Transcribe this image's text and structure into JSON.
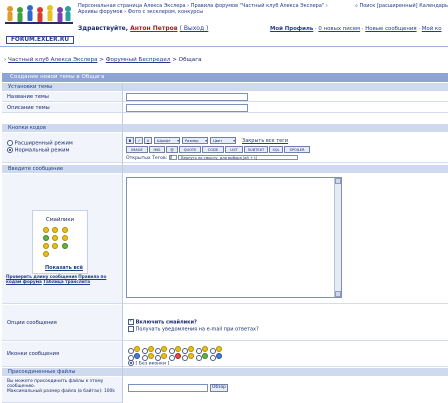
{
  "header": {
    "logo_text": "FORUM.EXLER.RU",
    "top_links": "Персональная страница Алекса Экслера › Правила форумов \"Частный клуб Алекса Экслера\" › Архивы форумов › Фото с эксклером, конкурсы",
    "top_links_right": "Поиск [расширенный] Календарь",
    "welcome_prefix": "Здравствуйте, ",
    "welcome_user": "Антон Петров",
    "welcome_logout": "( Выход )",
    "user_links": [
      "Мой Профиль",
      "0 новых писем",
      "Новые сообщения",
      "Мой ко"
    ]
  },
  "breadcrumb": {
    "items": [
      "Частный клуб Алекса Экслера",
      "Форумный Беспредел",
      "Общага"
    ],
    "sep": ">"
  },
  "form": {
    "title": "Создание новой темы в Общага",
    "section_topic": "Установки темы",
    "topic_name_label": "Название темы",
    "topic_desc_label": "Описание темы",
    "section_code": "Кнопки кодов",
    "mode_extended": "Расширенный режим",
    "mode_normal": "Нормальный режим",
    "close_all_tags": "Закрыть все теги",
    "fmt_buttons_row1": [
      "B",
      "I",
      "U",
      "Шрифт",
      "Размер",
      "Цвет"
    ],
    "fmt_buttons_row2": [
      "IMAGE",
      "IMG",
      "@",
      "QUOTE",
      "CODE",
      "LIST",
      "SUBTEXT",
      "SQL",
      "SPOILER"
    ],
    "open_tags_label": "Открытых Тегов:",
    "open_tags_value": "0",
    "hint_text": "Вернуть по смыслу, для выбора [alt + t]",
    "section_message": "Введите сообщение",
    "smilies_title": "Смайлики",
    "show_all": "Показать всё",
    "check_length": "Проверить длину сообщения",
    "forum_rules": "Правила по кодам форума",
    "translit": "Таблица транслита",
    "options_label": "Опции сообщения",
    "enable_smilies": "Включить смайлики?",
    "email_notify": "Получать уведомления на e-mail при ответах?",
    "icons_label": "Иконки сообщения",
    "no_icon": "[ Без иконки ]",
    "section_attach": "Присоединенные файлы",
    "attach_text_1": "Вы можете присоединить файлы к этому сообщению.",
    "attach_text_2": "Максимальный размер файла (в байтах): 100k",
    "browse_button": "Обзор"
  }
}
